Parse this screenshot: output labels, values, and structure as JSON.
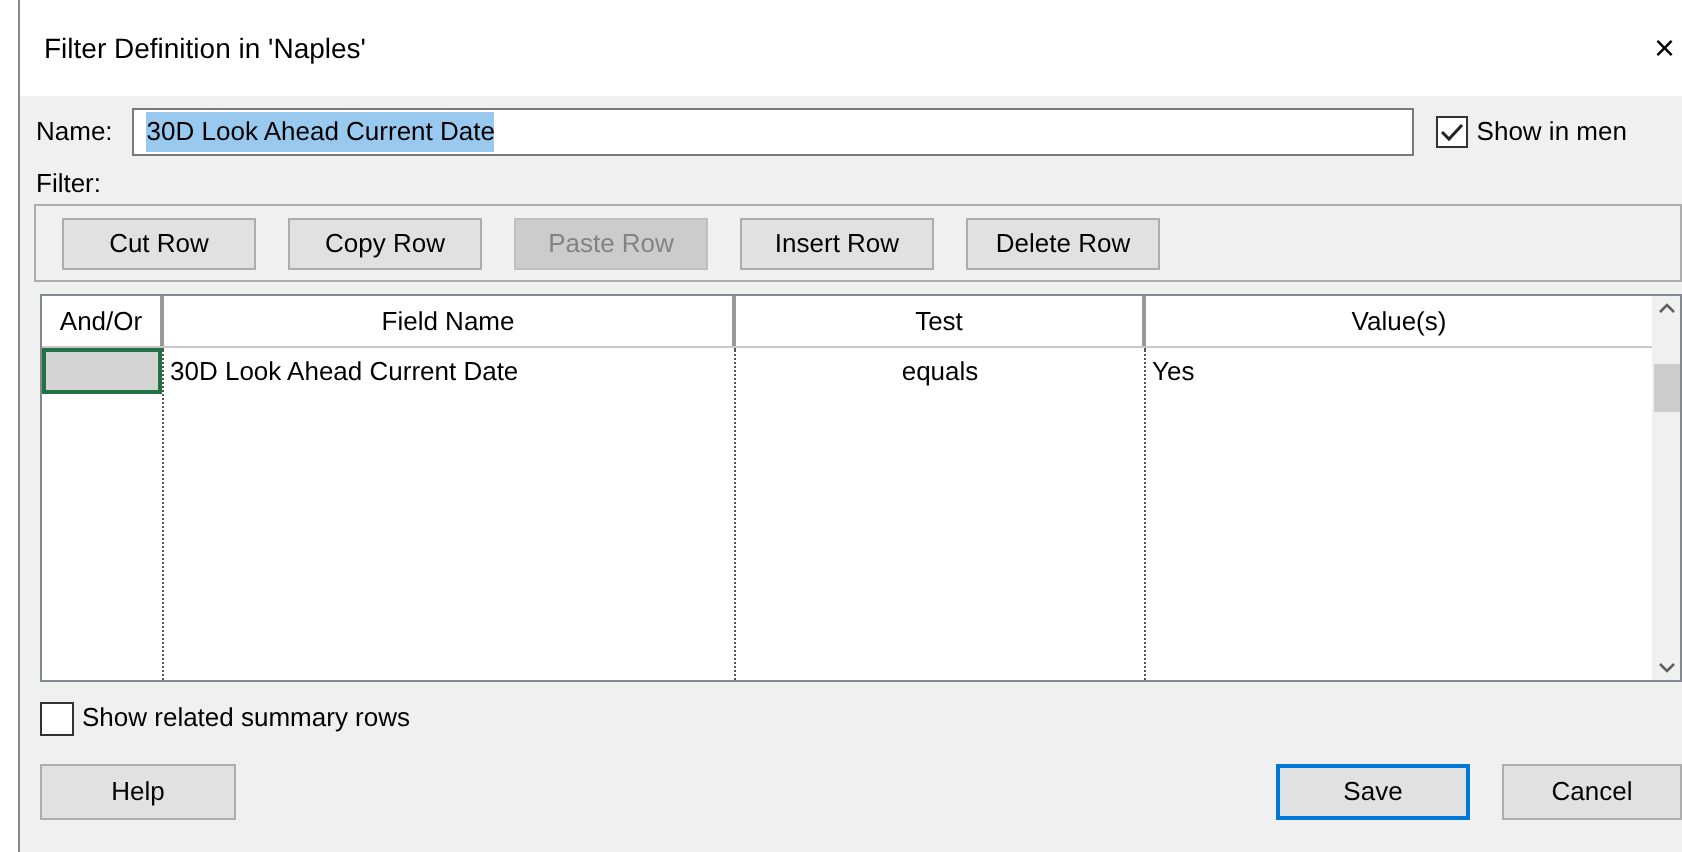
{
  "window": {
    "title": "Filter Definition in 'Naples'",
    "close": "×"
  },
  "name_field": {
    "label": "Name:",
    "value": "30D Look Ahead Current Date"
  },
  "show_in_menu": {
    "label": "Show in men",
    "checked": true
  },
  "filter_label": "Filter:",
  "toolbar": [
    {
      "label": "Cut Row",
      "disabled": false
    },
    {
      "label": "Copy Row",
      "disabled": false
    },
    {
      "label": "Paste Row",
      "disabled": true
    },
    {
      "label": "Insert Row",
      "disabled": false
    },
    {
      "label": "Delete Row",
      "disabled": false
    }
  ],
  "table": {
    "columns": [
      "And/Or",
      "Field Name",
      "Test",
      "Value(s)"
    ],
    "rows": [
      {
        "cells": [
          "",
          "30D Look Ahead Current Date",
          "equals",
          "Yes"
        ],
        "selected": true
      }
    ]
  },
  "show_related_summary_rows": {
    "label": "Show related summary rows",
    "checked": false
  },
  "buttons": [
    {
      "label": "Help",
      "kind": "help"
    },
    {
      "label": "Save",
      "kind": "default"
    },
    {
      "label": "Cancel",
      "kind": "normal"
    }
  ]
}
